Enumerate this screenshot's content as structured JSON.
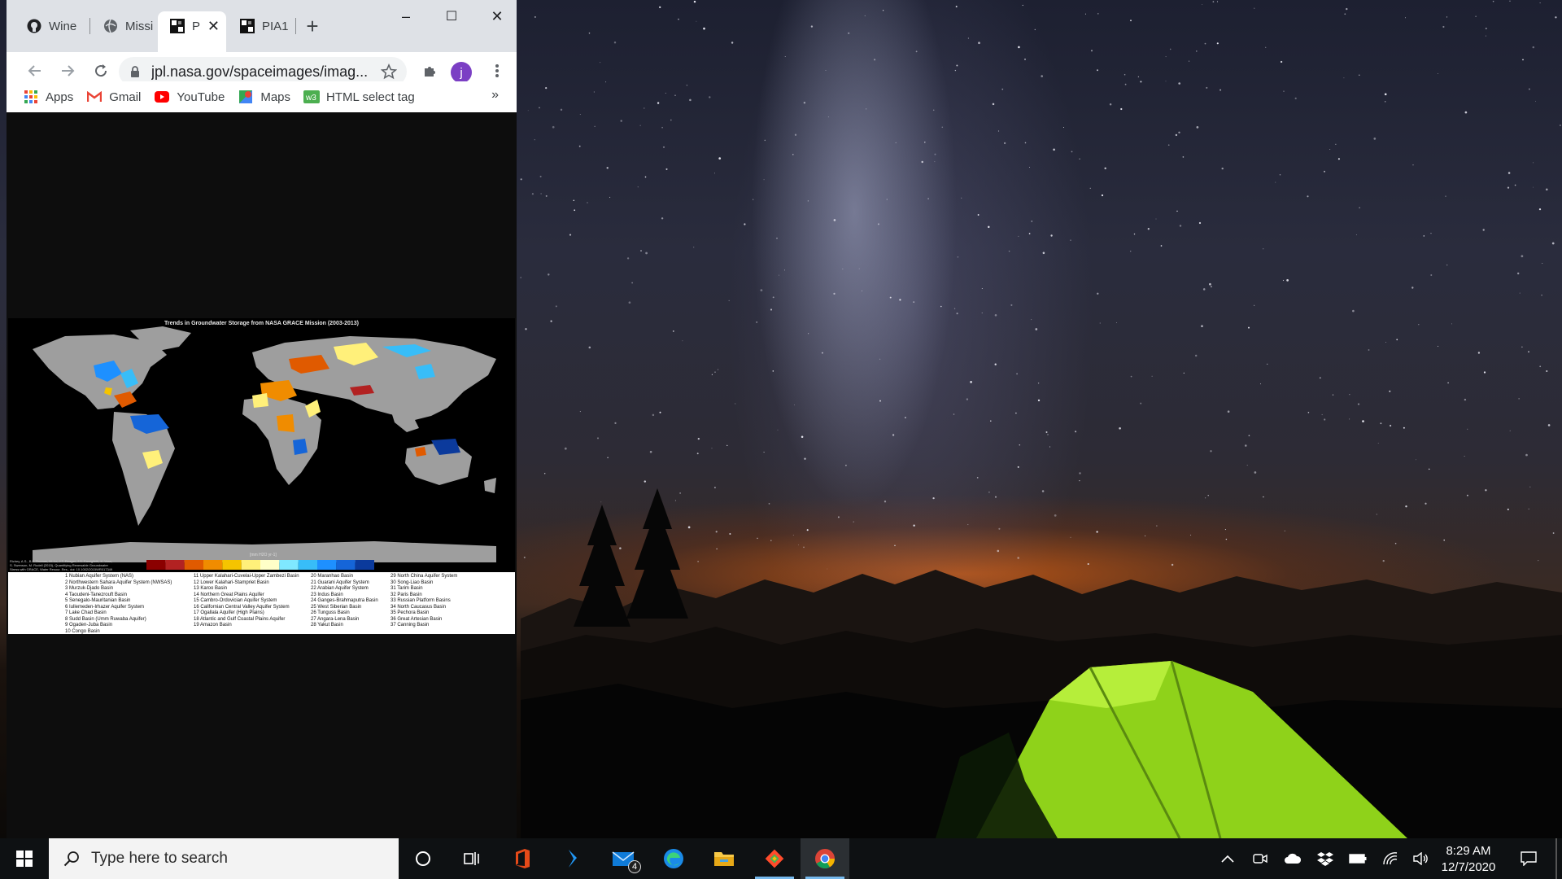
{
  "browser": {
    "tabs": [
      {
        "title": "Wine",
        "icon": "github-icon",
        "active": false
      },
      {
        "title": "Missi",
        "icon": "globe-icon",
        "active": false
      },
      {
        "title": "P",
        "icon": "nasa-image-icon",
        "active": true
      },
      {
        "title": "PIA1",
        "icon": "nasa-image-icon",
        "active": false
      }
    ],
    "window_controls": {
      "minimize": "–",
      "maximize": "☐",
      "close": "✕"
    },
    "url": "jpl.nasa.gov/spaceimages/imag...",
    "profile_initial": "j",
    "bookmarks": [
      {
        "label": "Apps",
        "icon": "apps-grid-icon"
      },
      {
        "label": "Gmail",
        "icon": "gmail-icon"
      },
      {
        "label": "YouTube",
        "icon": "youtube-icon"
      },
      {
        "label": "Maps",
        "icon": "maps-icon"
      },
      {
        "label": "HTML select tag",
        "icon": "w3schools-icon"
      }
    ],
    "bookmarks_overflow": "»"
  },
  "page_image": {
    "title": "Trends in Groundwater Storage from NASA GRACE Mission (2003-2013)",
    "colorbar_label": "[mm H2O yr-1]",
    "citation": "Richey, A.S., B.F. Thomas, M. Lo, J.T. Reager, J.S. Famiglietti, K. Voss, S. Swenson, M. Rodell (2015), Quantifying Renewable Groundwater Stress with GRACE, Water Resour. Res., doi: 10.1002/2015WR017349",
    "colors": [
      "#8b0000",
      "#b22222",
      "#e05a00",
      "#f08c00",
      "#f5c400",
      "#fff07a",
      "#ffffc8",
      "#7fe8ff",
      "#38bdf8",
      "#1e90ff",
      "#1565d8",
      "#0b3a9c"
    ],
    "legend": {
      "col1": [
        "1   Nubian Aquifer System (NAS)",
        "2   Northwestern Sahara Aquifer System (NWSAS)",
        "3   Murzuk-Djado Basin",
        "4   Taoudeni-Tanezrouft Basin",
        "5   Senegalo-Mauritanian Basin",
        "6   Iullemeden-Irhazer Aquifer System",
        "7   Lake Chad Basin",
        "8   Sudd Basin (Umm Ruwaba Aquifer)",
        "9   Ogaden-Juba Basin",
        "10  Congo Basin"
      ],
      "col2": [
        "11  Upper Kalahari-Cuvelai-Upper Zambezi Basin",
        "12  Lower Kalahari-Stampriet Basin",
        "13  Karoo Basin",
        "14  Northern Great Plains Aquifer",
        "15  Cambro-Ordovician Aquifer System",
        "16  Californian Central Valley Aquifer System",
        "17  Ogallala Aquifer (High Plains)",
        "18  Atlantic and Gulf Coastal Plains Aquifer",
        "19  Amazon Basin"
      ],
      "col3": [
        "20  Maranhao Basin",
        "21  Guarani Aquifer System",
        "22  Arabian Aquifer System",
        "23  Indus Basin",
        "24  Ganges-Brahmaputra Basin",
        "25  West Siberian Basin",
        "26  Tunguss Basin",
        "27  Angara-Lena Basin",
        "28  Yakut Basin"
      ],
      "col4": [
        "29  North China Aquifer System",
        "30  Song-Liao Basin",
        "31  Tarim Basin",
        "32  Paris Basin",
        "33  Russian Platform Basins",
        "34  North Caucasus Basin",
        "35  Pechora Basin",
        "36  Great Artesian Basin",
        "37  Canning Basin"
      ]
    }
  },
  "taskbar": {
    "search_placeholder": "Type here to search",
    "mail_badge": "4",
    "time": "8:29 AM",
    "date": "12/7/2020"
  }
}
